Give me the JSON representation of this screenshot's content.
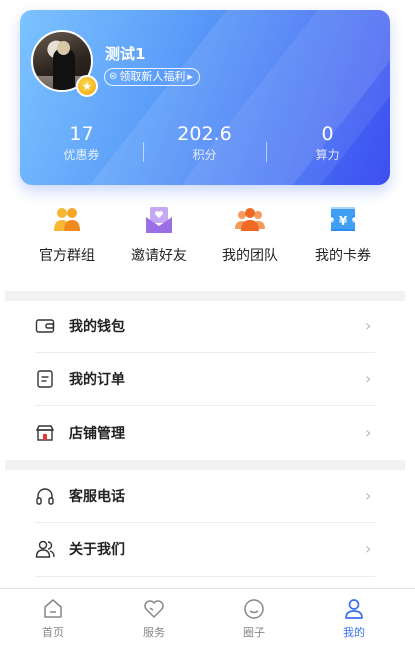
{
  "profile": {
    "username": "测试1",
    "newbie_tag": "领取新人福利",
    "stats": [
      {
        "value": "17",
        "label": "优惠券"
      },
      {
        "value": "202.6",
        "label": "积分"
      },
      {
        "value": "0",
        "label": "算力"
      }
    ]
  },
  "quick_actions": [
    {
      "label": "官方群组",
      "icon": "group-icon",
      "color": "#f5a623"
    },
    {
      "label": "邀请好友",
      "icon": "invite-envelope-icon",
      "color": "#a178e8"
    },
    {
      "label": "我的团队",
      "icon": "team-icon",
      "color": "#f57a3a"
    },
    {
      "label": "我的卡券",
      "icon": "coupon-yen-icon",
      "color": "#2e8df0"
    }
  ],
  "menu_group_1": [
    {
      "label": "我的钱包",
      "icon": "wallet-icon"
    },
    {
      "label": "我的订单",
      "icon": "order-icon"
    },
    {
      "label": "店铺管理",
      "icon": "shop-icon"
    }
  ],
  "menu_group_2": [
    {
      "label": "客服电话",
      "icon": "headset-icon"
    },
    {
      "label": "关于我们",
      "icon": "about-users-icon"
    }
  ],
  "tabbar": [
    {
      "label": "首页",
      "icon": "home-icon",
      "active": false
    },
    {
      "label": "服务",
      "icon": "heart-icon",
      "active": false
    },
    {
      "label": "圈子",
      "icon": "circle-face-icon",
      "active": false
    },
    {
      "label": "我的",
      "icon": "user-icon",
      "active": true
    }
  ],
  "colors": {
    "accent": "#3a6ff2",
    "card_gradient_start": "#7cc3ff",
    "card_gradient_end": "#3e4ff0"
  }
}
